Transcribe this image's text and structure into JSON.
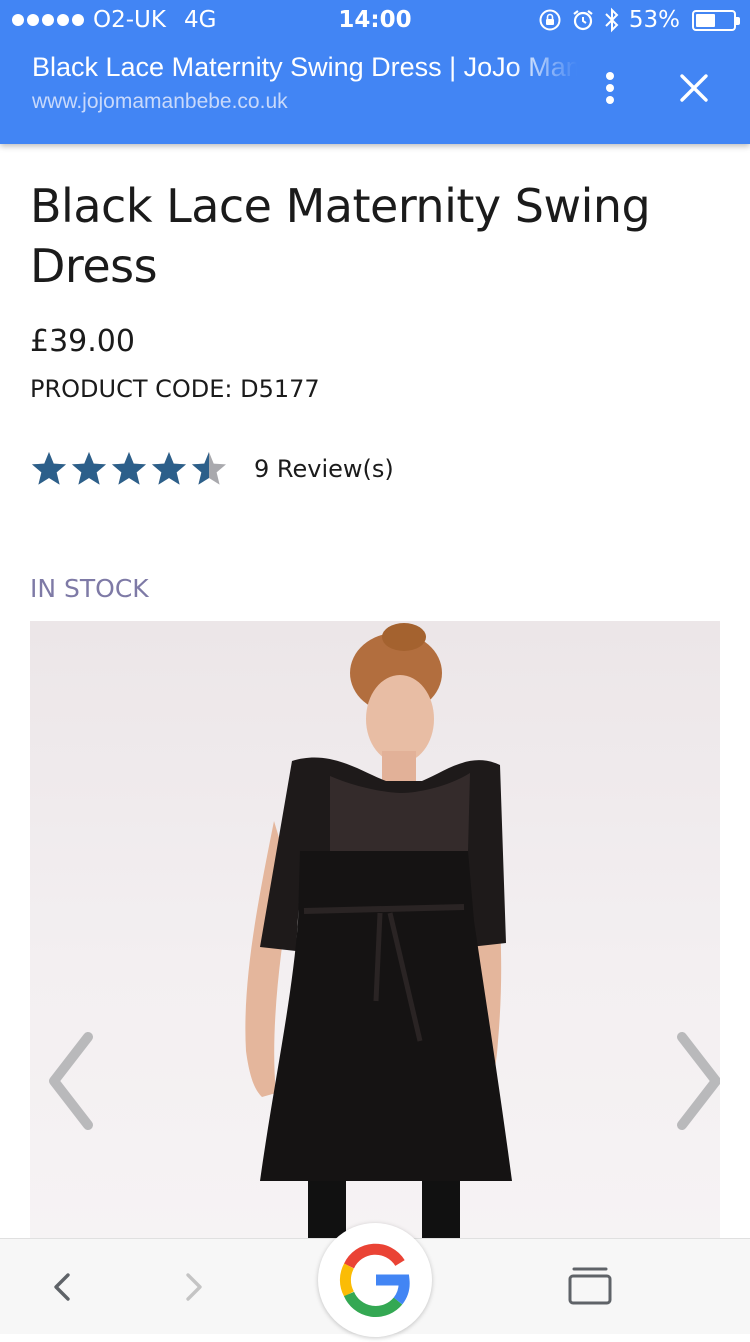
{
  "status_bar": {
    "carrier": "O2-UK",
    "network": "4G",
    "time": "14:00",
    "battery": "53%",
    "battery_level": 0.53
  },
  "browser": {
    "tab_title": "Black Lace Maternity Swing Dress | JoJo Maman Bébé",
    "url": "www.jojomamanbebe.co.uk",
    "accent_color": "#4285f4"
  },
  "product": {
    "title": "Black Lace Maternity Swing Dress",
    "price": "£39.00",
    "code": "PRODUCT CODE: D5177",
    "rating": 4.5,
    "rating_max": 5,
    "star_color": "#2c5f8a",
    "reviews": "9 Review(s)",
    "stock": "IN STOCK",
    "stock_color": "#7e7aa6"
  },
  "gallery": {
    "prev_icon": "chevron-left-icon",
    "next_icon": "chevron-right-icon"
  },
  "toolbar": {
    "back_icon": "arrow-back-icon",
    "forward_icon": "arrow-forward-icon",
    "google_icon": "google-g-icon",
    "tabs_icon": "tabs-icon"
  }
}
